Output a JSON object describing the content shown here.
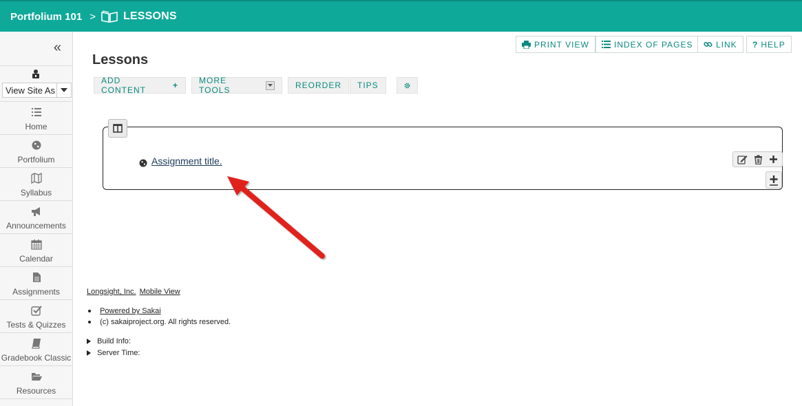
{
  "topbar": {
    "site_name": "Portfolium 101",
    "separator": ">",
    "tool_icon": "book-open-icon",
    "tool_name": "LESSONS",
    "bg_color": "#0fa99a"
  },
  "sidebar": {
    "collapse_icon": "double-chevron-left-icon",
    "view_as": {
      "icon": "user-lock-icon",
      "value": "View Site As"
    },
    "items": [
      {
        "label": "Home",
        "icon": "list-icon"
      },
      {
        "label": "Portfolium",
        "icon": "globe-icon"
      },
      {
        "label": "Syllabus",
        "icon": "map-icon"
      },
      {
        "label": "Announcements",
        "icon": "bullhorn-icon"
      },
      {
        "label": "Calendar",
        "icon": "calendar-icon"
      },
      {
        "label": "Assignments",
        "icon": "file-text-icon"
      },
      {
        "label": "Tests & Quizzes",
        "icon": "check-square-icon"
      },
      {
        "label": "Gradebook Classic",
        "icon": "book-icon"
      },
      {
        "label": "Resources",
        "icon": "folder-open-icon"
      }
    ]
  },
  "toolbar": {
    "print_view": "PRINT VIEW",
    "index_of_pages": "INDEX OF PAGES",
    "link": "LINK",
    "help": "HELP"
  },
  "page": {
    "title": "Lessons",
    "actions": {
      "add_content": "ADD CONTENT",
      "more_tools": "MORE TOOLS",
      "reorder": "REORDER",
      "tips": "TIPS"
    }
  },
  "content": {
    "item_link": "Assignment title.",
    "item_icon": "globe-icon"
  },
  "footer": {
    "longsight": "Longsight, Inc.",
    "mobile_view": "Mobile View",
    "powered_by": "Powered by Sakai",
    "copyright": "(c) sakaiproject.org. All rights reserved.",
    "build_info": "Build Info:",
    "server_time": "Server Time:"
  },
  "accent_color": "#0a8a7e",
  "annotation_arrow_color": "#e0201e"
}
